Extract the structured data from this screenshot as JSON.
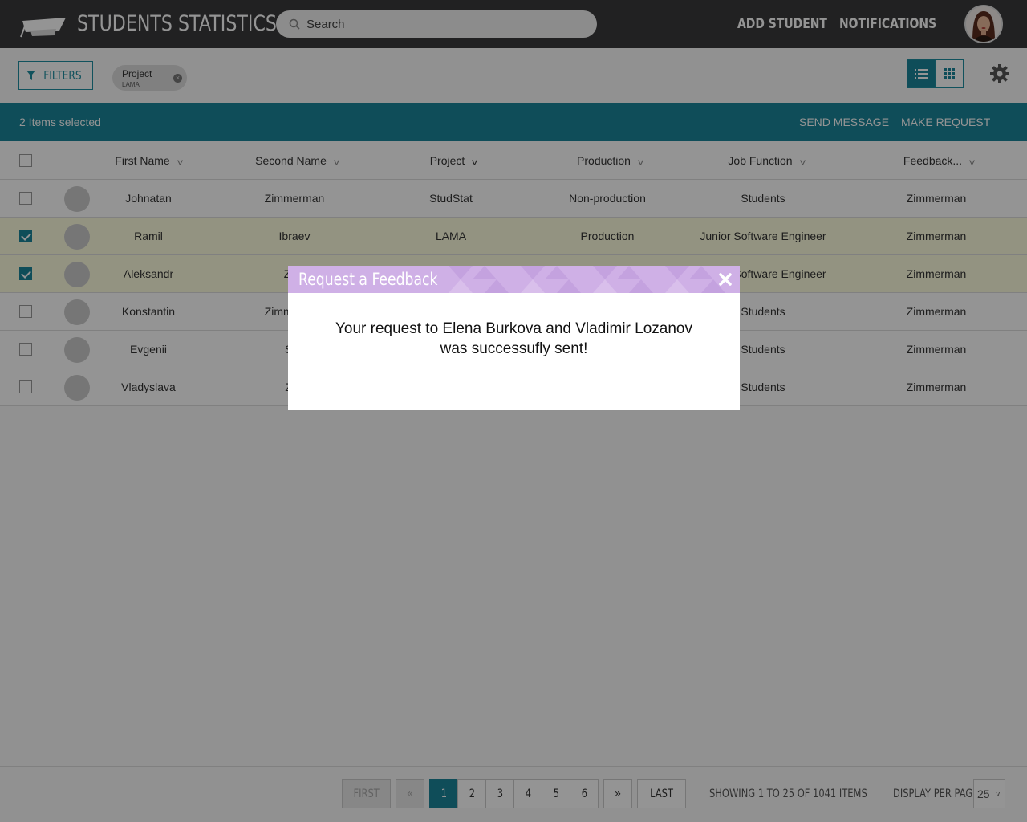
{
  "header": {
    "title": "STUDENTS STATISTICS",
    "search_placeholder": "Search",
    "nav": [
      "ADD STUDENT",
      "NOTIFICATIONS"
    ]
  },
  "toolbar": {
    "filters_label": "FILTERS",
    "chip": {
      "title": "Project",
      "value": "LAMA"
    }
  },
  "selection": {
    "count_text": "2 Items selected",
    "send_message": "SEND MESSAGE",
    "make_request": "MAKE REQUEST"
  },
  "table": {
    "columns": [
      "First Name",
      "Second Name",
      "Project",
      "Production",
      "Job Function",
      "Feedback..."
    ],
    "rows": [
      {
        "selected": false,
        "cells": [
          "Johnatan",
          "Zimmerman",
          "StudStat",
          "Non-production",
          "Students",
          "Zimmerman"
        ]
      },
      {
        "selected": true,
        "cells": [
          "Ramil",
          "Ibraev",
          "LAMA",
          "Production",
          "Junior Software Engineer",
          "Zimmerman"
        ]
      },
      {
        "selected": true,
        "cells": [
          "Aleksandr",
          "Zinc",
          "",
          "",
          "Junior Software Engineer",
          "Zimmerman"
        ]
      },
      {
        "selected": false,
        "cells": [
          "Konstantin",
          "Zimmerman",
          "",
          "",
          "Students",
          "Zimmerman"
        ]
      },
      {
        "selected": false,
        "cells": [
          "Evgenii",
          "Sev",
          "",
          "",
          "Students",
          "Zimmerman"
        ]
      },
      {
        "selected": false,
        "cells": [
          "Vladyslava",
          "Zyg",
          "",
          "",
          "Students",
          "Zimmerman"
        ]
      }
    ]
  },
  "pagination": {
    "first": "FIRST",
    "prev": "«",
    "pages": [
      "1",
      "2",
      "3",
      "4",
      "5",
      "6"
    ],
    "current_page": "1",
    "next": "»",
    "last": "LAST",
    "showing": "SHOWING 1 TO 25 OF 1041 ITEMS",
    "display_per_page_label": "DISPLAY PER PAGE",
    "per_page": "25"
  },
  "modal": {
    "title": "Request a Feedback",
    "message_line1": "Your request to Elena Burkova and Vladimir Lozanov",
    "message_line2": "was successufly sent!"
  },
  "colors": {
    "header_bg": "#3a3a3c",
    "accent": "#1b8599",
    "selected_row": "#fdfddf",
    "modal_header": "#cfb0e6"
  }
}
